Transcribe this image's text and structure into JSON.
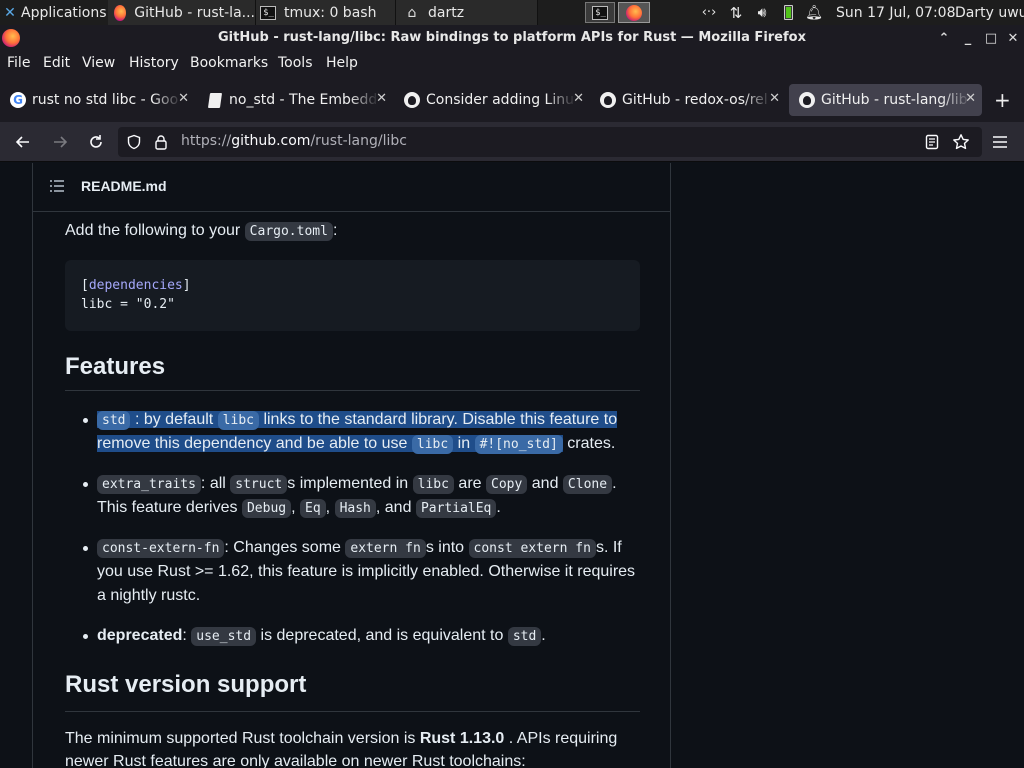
{
  "taskbar": {
    "applications": "Applications",
    "windows": [
      {
        "label": "GitHub - rust-la..."
      },
      {
        "label": "tmux: 0 bash"
      },
      {
        "label": "dartz"
      }
    ],
    "clock": "Sun 17 Jul, 07:08",
    "user": "Darty uwu"
  },
  "window": {
    "title": "GitHub - rust-lang/libc: Raw bindings to platform APIs for Rust — Mozilla Firefox"
  },
  "menubar": {
    "file": "File",
    "edit": "Edit",
    "view": "View",
    "history": "History",
    "bookmarks": "Bookmarks",
    "tools": "Tools",
    "help": "Help"
  },
  "tabs": [
    {
      "label": "rust no std libc - Goo"
    },
    {
      "label": "no_std - The Embedd"
    },
    {
      "label": "Consider adding Linu"
    },
    {
      "label": "GitHub - redox-os/rel"
    },
    {
      "label": "GitHub - rust-lang/lib"
    }
  ],
  "url": {
    "prefix": "https://",
    "host": "github.com",
    "path": "/rust-lang/libc"
  },
  "readme": {
    "title": "README.md",
    "intro_text": "Add the following to your",
    "intro_code": "Cargo.toml",
    "intro_colon": ":",
    "code_line1_key": "dependencies",
    "code_line2": "libc = \"0.2\"",
    "features_heading": "Features",
    "std": {
      "code1": "std",
      "t1": ": by default",
      "code2": "libc",
      "t2": "links to the standard library. Disable this feature to",
      "t3": "remove this dependency and be able to use",
      "code3": "libc",
      "t4": "in",
      "code4": "#![no_std]",
      "t5": "crates."
    },
    "extra": {
      "code1": "extra_traits",
      "t1": ": all",
      "code2": "struct",
      "t2": "s implemented in",
      "code3": "libc",
      "t3": "are",
      "code4": "Copy",
      "t4": "and",
      "code5": "Clone",
      "t5": ".",
      "t6": "This feature derives",
      "code6": "Debug",
      "t7": ",",
      "code7": "Eq",
      "t8": ",",
      "code8": "Hash",
      "t9": ", and",
      "code9": "PartialEq",
      "t10": "."
    },
    "cef": {
      "code1": "const-extern-fn",
      "t1": ": Changes some",
      "code2": "extern fn",
      "t2": "s into",
      "code3": "const extern fn",
      "t3": "s. If",
      "t4": "you use Rust >= 1.62, this feature is implicitly enabled. Otherwise it requires",
      "t5": "a nightly rustc."
    },
    "deprecated": {
      "b1": "deprecated",
      "t1": ":",
      "code1": "use_std",
      "t2": "is deprecated, and is equivalent to",
      "code2": "std",
      "t3": "."
    },
    "rust_version_heading": "Rust version support",
    "min_text": "The minimum supported Rust toolchain version is",
    "min_version": "Rust 1.13.0",
    "min_text2": ". APIs requiring",
    "min_text3": "newer Rust features are only available on newer Rust toolchains:"
  }
}
